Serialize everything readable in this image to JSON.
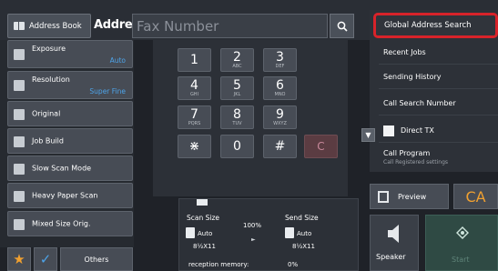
{
  "toolbar": {
    "address_book_label": "Address Book",
    "address_label": "Address",
    "fax_placeholder": "Fax Number"
  },
  "left_menu": [
    {
      "title": "Exposure",
      "value": "Auto"
    },
    {
      "title": "Resolution",
      "value": "Super Fine"
    },
    {
      "title": "Original",
      "value": ""
    },
    {
      "title": "Job Build",
      "value": ""
    },
    {
      "title": "Slow Scan Mode",
      "value": ""
    },
    {
      "title": "Heavy Paper Scan",
      "value": ""
    },
    {
      "title": "Mixed Size Orig.",
      "value": ""
    }
  ],
  "bottom": {
    "others_label": "Others"
  },
  "keypad": {
    "keys": [
      {
        "digit": "1",
        "sub": ""
      },
      {
        "digit": "2",
        "sub": "ABC"
      },
      {
        "digit": "3",
        "sub": "DEF"
      },
      {
        "digit": "4",
        "sub": "GHI"
      },
      {
        "digit": "5",
        "sub": "JKL"
      },
      {
        "digit": "6",
        "sub": "MNO"
      },
      {
        "digit": "7",
        "sub": "PQRS"
      },
      {
        "digit": "8",
        "sub": "TUV"
      },
      {
        "digit": "9",
        "sub": "WXYZ"
      },
      {
        "digit": "⋇",
        "sub": ""
      },
      {
        "digit": "0",
        "sub": ""
      },
      {
        "digit": "#",
        "sub": ""
      }
    ],
    "clear_label": "C"
  },
  "scan": {
    "scan_size_label": "Scan Size",
    "send_size_label": "Send Size",
    "scan_mode": "Auto",
    "send_mode": "Auto",
    "scan_paper": "8½X11",
    "send_paper": "8½X11",
    "ratio": "100%",
    "memory_label": "reception memory:",
    "memory_value": "0%"
  },
  "right_menu": {
    "global_address_search": "Global Address Search",
    "recent_jobs": "Recent Jobs",
    "sending_history": "Sending History",
    "call_search_number": "Call Search Number",
    "direct_tx": "Direct TX",
    "call_program": "Call Program",
    "call_registered": "Call Registered settings"
  },
  "actions": {
    "preview_label": "Preview",
    "ca_label": "CA",
    "speaker_label": "Speaker",
    "start_label": "Start"
  },
  "colors": {
    "accent": "#4da3e8",
    "highlight": "#d8232a",
    "ca": "#f0a030"
  }
}
